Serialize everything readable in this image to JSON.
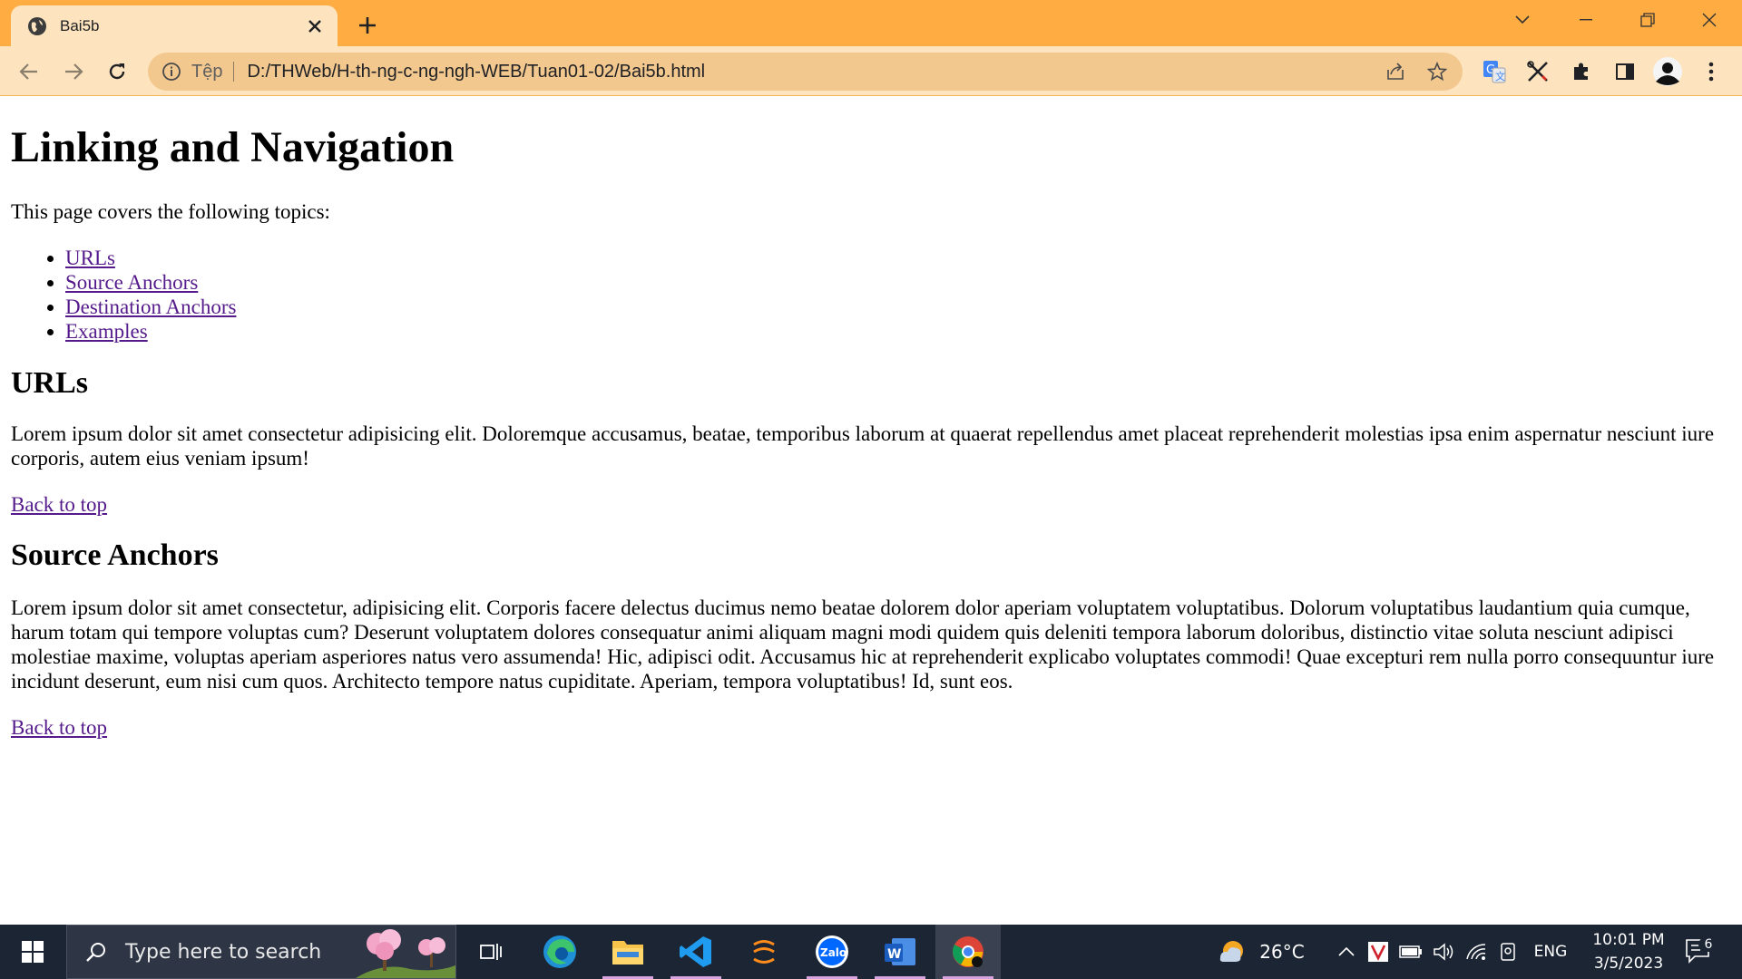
{
  "browser": {
    "tab": {
      "title": "Bai5b"
    },
    "omnibox": {
      "scheme_label": "Tệp",
      "url": "D:/THWeb/H-th-ng-c-ng-ngh-WEB/Tuan01-02/Bai5b.html"
    }
  },
  "page": {
    "title": "Linking and Navigation",
    "intro": "This page covers the following topics:",
    "toc": [
      {
        "label": "URLs"
      },
      {
        "label": "Source Anchors"
      },
      {
        "label": "Destination Anchors"
      },
      {
        "label": "Examples"
      }
    ],
    "sections": [
      {
        "heading": "URLs",
        "body": "Lorem ipsum dolor sit amet consectetur adipisicing elit. Doloremque accusamus, beatae, temporibus laborum at quaerat repellendus amet placeat reprehenderit molestias ipsa enim aspernatur nesciunt iure corporis, autem eius veniam ipsum!",
        "back_link": "Back to top"
      },
      {
        "heading": "Source Anchors",
        "body": "Lorem ipsum dolor sit amet consectetur, adipisicing elit. Corporis facere delectus ducimus nemo beatae dolorem dolor aperiam voluptatem voluptatibus. Dolorum voluptatibus laudantium quia cumque, harum totam qui tempore voluptas cum? Deserunt voluptatem dolores consequatur animi aliquam magni modi quidem quis deleniti tempora laborum doloribus, distinctio vitae soluta nesciunt adipisci molestiae maxime, voluptas aperiam asperiores natus vero assumenda! Hic, adipisci odit. Accusamus hic at reprehenderit explicabo voluptates commodi! Quae excepturi rem nulla porro consequuntur iure incidunt deserunt, eum nisi cum quos. Architecto tempore natus cupiditate. Aperiam, tempora voluptatibus! Id, sunt eos.",
        "back_link": "Back to top"
      }
    ]
  },
  "taskbar": {
    "search_placeholder": "Type here to search",
    "weather": {
      "temp": "26°C"
    },
    "language": "ENG",
    "clock": {
      "time": "10:01 PM",
      "date": "3/5/2023"
    },
    "notifications": {
      "count": "6"
    }
  },
  "colors": {
    "tabstrip": "#ffad42",
    "toolbar": "#fde4be",
    "link_visited": "#551a8b",
    "taskbar": "#1c2534"
  },
  "icons": [
    "globe-icon",
    "close-icon",
    "plus-icon",
    "chevron-down-icon",
    "minimize-icon",
    "restore-icon",
    "back-icon",
    "forward-icon",
    "reload-icon",
    "info-icon",
    "share-icon",
    "star-icon",
    "translate-icon",
    "tools-extension-icon",
    "puzzle-icon",
    "side-panel-icon",
    "avatar",
    "kebab-menu-icon",
    "windows-icon",
    "search-icon",
    "task-view-icon",
    "edge-icon",
    "file-explorer-icon",
    "vscode-icon",
    "sublime-icon",
    "zalo-icon",
    "word-icon",
    "chrome-icon",
    "weather-icon",
    "chevron-up-icon",
    "vivaldi-icon",
    "battery-icon",
    "volume-icon",
    "wifi-icon",
    "meet-now-icon",
    "notification-icon"
  ]
}
